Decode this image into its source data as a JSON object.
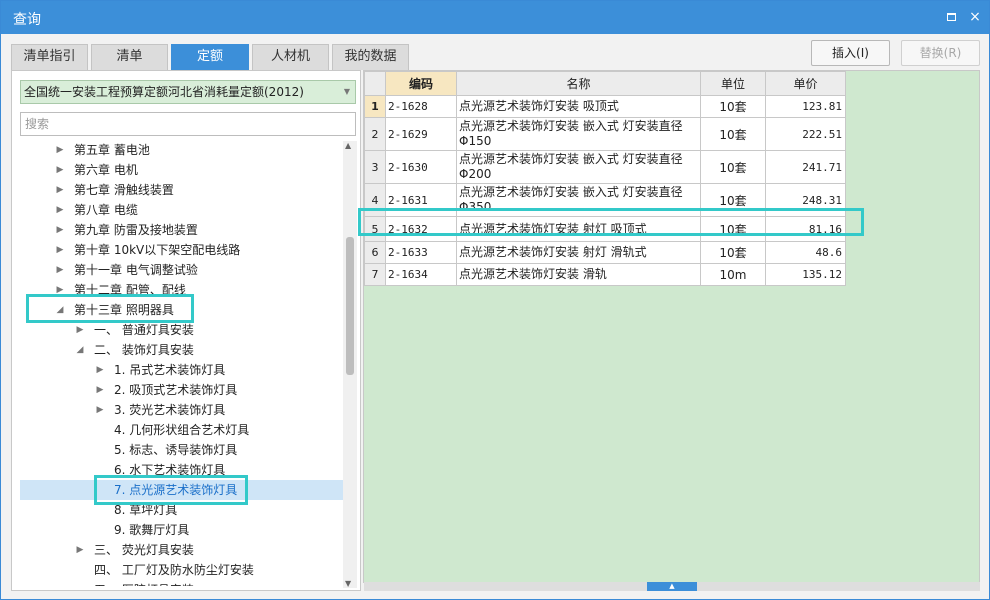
{
  "window": {
    "title": "查询",
    "maximize_glyph": "□",
    "close_glyph": "×"
  },
  "tabs": [
    {
      "label": "清单指引",
      "active": false
    },
    {
      "label": "清单",
      "active": false
    },
    {
      "label": "定额",
      "active": true
    },
    {
      "label": "人材机",
      "active": false
    },
    {
      "label": "我的数据",
      "active": false
    }
  ],
  "buttons": {
    "insert": "插入(I)",
    "replace": "替换(R)"
  },
  "library": {
    "selected": "全国统一安装工程预算定额河北省消耗量定额(2012)"
  },
  "search": {
    "placeholder": "搜索"
  },
  "tree": [
    {
      "label": "第五章 蓄电池",
      "toggle": "▶",
      "level": 0
    },
    {
      "label": "第六章 电机",
      "toggle": "▶",
      "level": 0
    },
    {
      "label": "第七章 滑触线装置",
      "toggle": "▶",
      "level": 0
    },
    {
      "label": "第八章 电缆",
      "toggle": "▶",
      "level": 0
    },
    {
      "label": "第九章 防雷及接地装置",
      "toggle": "▶",
      "level": 0
    },
    {
      "label": "第十章 10kV以下架空配电线路",
      "toggle": "▶",
      "level": 0
    },
    {
      "label": "第十一章 电气调整试验",
      "toggle": "▶",
      "level": 0
    },
    {
      "label": "第十二章 配管、配线",
      "toggle": "▶",
      "level": 0
    },
    {
      "label": "第十三章 照明器具",
      "toggle": "◢",
      "level": 0
    },
    {
      "label": "一、 普通灯具安装",
      "toggle": "▶",
      "level": 1
    },
    {
      "label": "二、 装饰灯具安装",
      "toggle": "◢",
      "level": 1
    },
    {
      "label": "1. 吊式艺术装饰灯具",
      "toggle": "▶",
      "level": 2
    },
    {
      "label": "2. 吸顶式艺术装饰灯具",
      "toggle": "▶",
      "level": 2
    },
    {
      "label": "3. 荧光艺术装饰灯具",
      "toggle": "▶",
      "level": 2
    },
    {
      "label": "4. 几何形状组合艺术灯具",
      "toggle": "",
      "level": 2
    },
    {
      "label": "5. 标志、诱导装饰灯具",
      "toggle": "",
      "level": 2
    },
    {
      "label": "6. 水下艺术装饰灯具",
      "toggle": "",
      "level": 2
    },
    {
      "label": "7. 点光源艺术装饰灯具",
      "toggle": "",
      "level": 2,
      "selected": true
    },
    {
      "label": "8. 草坪灯具",
      "toggle": "",
      "level": 2
    },
    {
      "label": "9. 歌舞厅灯具",
      "toggle": "",
      "level": 2
    },
    {
      "label": "三、 荧光灯具安装",
      "toggle": "▶",
      "level": 1
    },
    {
      "label": "四、 工厂灯及防水防尘灯安装",
      "toggle": "",
      "level": 1
    },
    {
      "label": "五、 医院灯具安装",
      "toggle": "",
      "level": 1
    }
  ],
  "grid": {
    "headers": {
      "code": "编码",
      "name": "名称",
      "unit": "单位",
      "price": "单价"
    },
    "rows": [
      {
        "idx": "1",
        "code": "2-1628",
        "name": "点光源艺术装饰灯安装 吸顶式",
        "unit": "10套",
        "price": "123.81",
        "current": true
      },
      {
        "idx": "2",
        "code": "2-1629",
        "name": "点光源艺术装饰灯安装 嵌入式 灯安装直径Φ150",
        "unit": "10套",
        "price": "222.51"
      },
      {
        "idx": "3",
        "code": "2-1630",
        "name": "点光源艺术装饰灯安装 嵌入式 灯安装直径Φ200",
        "unit": "10套",
        "price": "241.71"
      },
      {
        "idx": "4",
        "code": "2-1631",
        "name": "点光源艺术装饰灯安装 嵌入式 灯安装直径Φ350",
        "unit": "10套",
        "price": "248.31"
      },
      {
        "idx": "5",
        "code": "2-1632",
        "name": "点光源艺术装饰灯安装 射灯 吸顶式",
        "unit": "10套",
        "price": "81.16"
      },
      {
        "idx": "6",
        "code": "2-1633",
        "name": "点光源艺术装饰灯安装 射灯 滑轨式",
        "unit": "10套",
        "price": "48.6"
      },
      {
        "idx": "7",
        "code": "2-1634",
        "name": "点光源艺术装饰灯安装 滑轨",
        "unit": "10m",
        "price": "135.12"
      }
    ]
  },
  "colors": {
    "accent": "#3c8fd9",
    "highlight": "#33c9c9",
    "grid_bg": "#cfe8cf",
    "selected_row": "#cfe5f7"
  }
}
